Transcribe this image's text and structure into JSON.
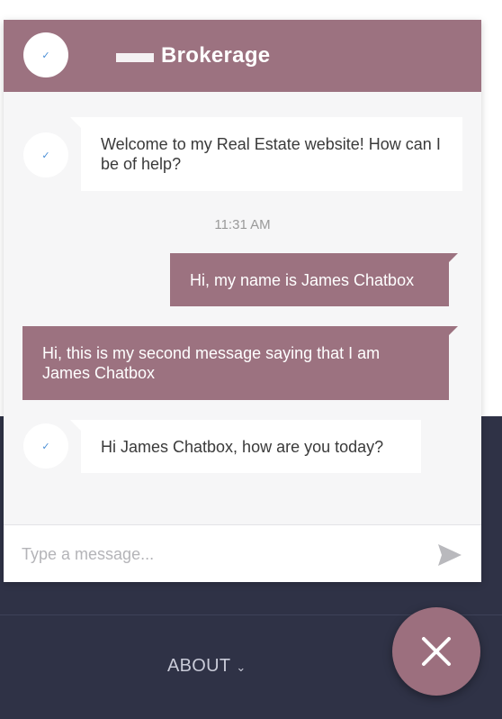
{
  "header": {
    "title": "Brokerage"
  },
  "messages": [
    {
      "sender": "bot",
      "text": "Welcome to my Real Estate website! How can I be of help?"
    },
    {
      "sender": "user",
      "text": "Hi, my name is James Chatbox"
    },
    {
      "sender": "user",
      "text": "Hi, this is my second message saying that I am James Chatbox"
    },
    {
      "sender": "bot",
      "text": "Hi James Chatbox, how are you today?"
    }
  ],
  "timestamp": "11:31 AM",
  "input": {
    "placeholder": "Type a message..."
  },
  "nav": {
    "about_label": "ABOUT"
  },
  "icons": {
    "avatar_check": "✓",
    "send": "send-icon",
    "close": "close-icon",
    "chevron": "chevron-down-icon"
  },
  "colors": {
    "brand": "#9c7280",
    "fab": "#9c6f7e",
    "footer_bg": "#2f3246",
    "chat_bg": "#f6f6f7"
  }
}
